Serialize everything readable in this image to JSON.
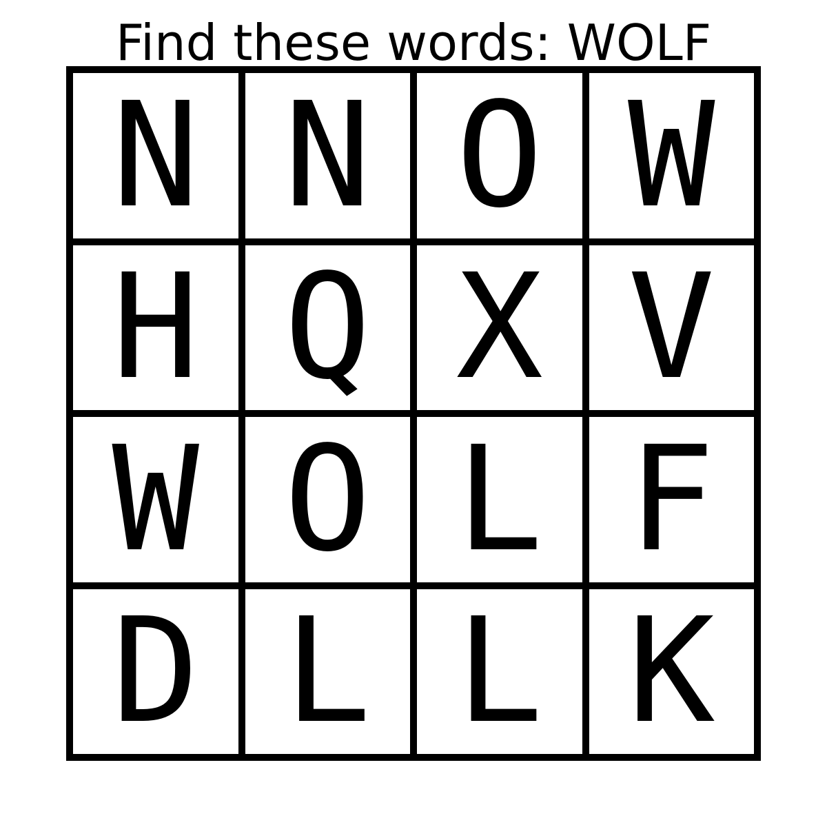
{
  "title": "Find these words: WOLF",
  "words": [
    "WOLF"
  ],
  "grid": [
    [
      "N",
      "N",
      "O",
      "W"
    ],
    [
      "H",
      "Q",
      "X",
      "V"
    ],
    [
      "W",
      "O",
      "L",
      "F"
    ],
    [
      "D",
      "L",
      "L",
      "K"
    ]
  ],
  "colors": {
    "background": "#ffffff",
    "grid_lines": "#000000",
    "text": "#000000"
  }
}
